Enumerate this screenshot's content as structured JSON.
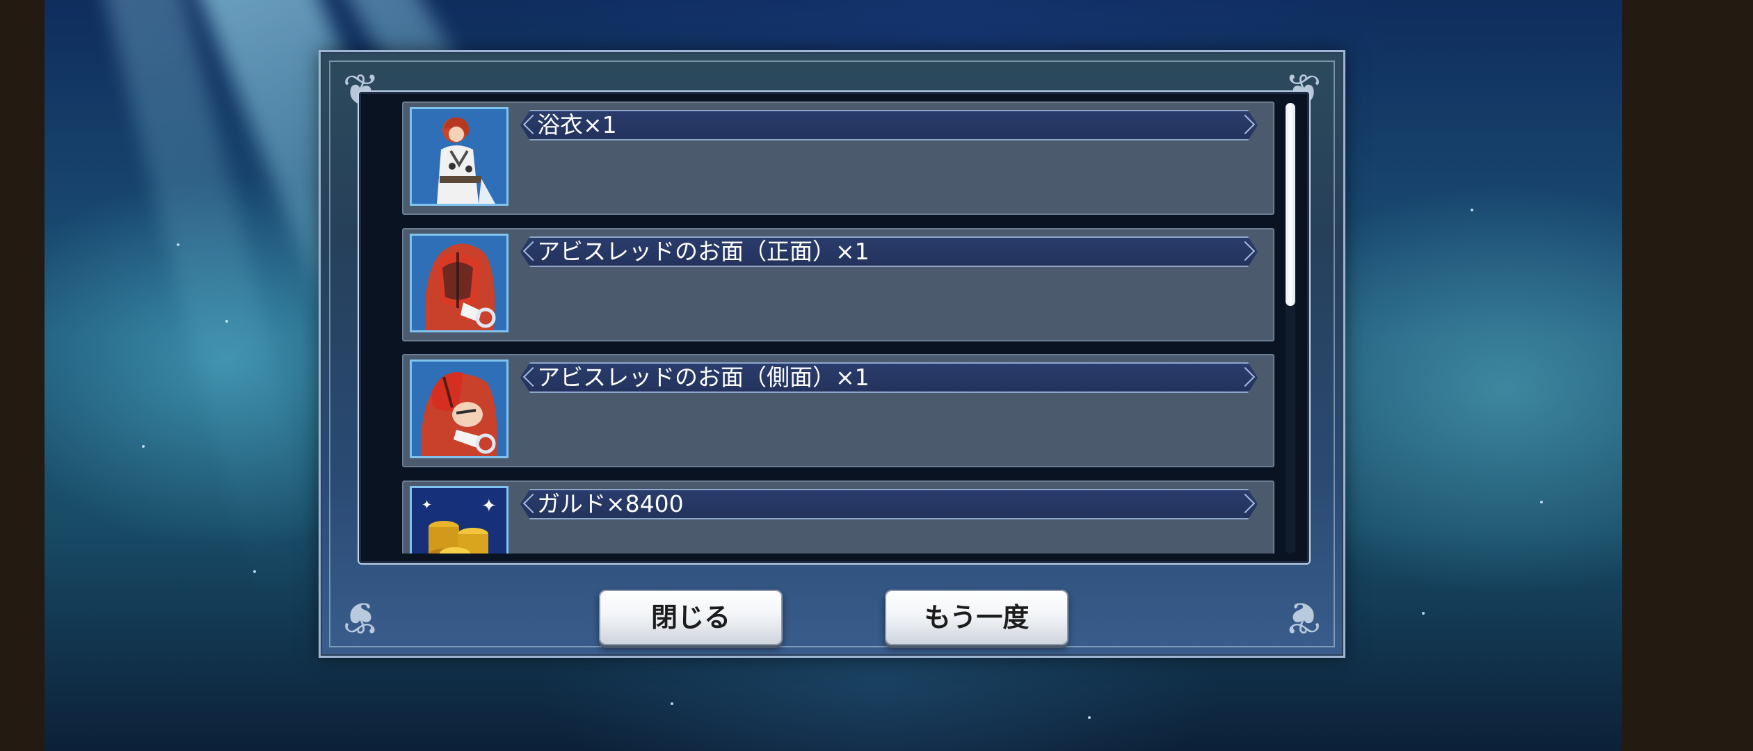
{
  "items": [
    {
      "name": "浴衣×1",
      "thumb_icon": "yukata-character-icon"
    },
    {
      "name": "アビスレッドのお面（正面）×1",
      "thumb_icon": "abyss-red-mask-front-icon"
    },
    {
      "name": "アビスレッドのお面（側面）×1",
      "thumb_icon": "abyss-red-mask-side-icon"
    },
    {
      "name": "ガルド×8400",
      "thumb_icon": "gald-coins-icon"
    }
  ],
  "scroll": {
    "visible_fraction": 0.45,
    "position_fraction": 0.0
  },
  "buttons": {
    "close_label": "閉じる",
    "again_label": "もう一度"
  },
  "colors": {
    "accent_bar": "#23335d",
    "item_bg": "#4b5a6c",
    "thumb_border": "#7fc3ee"
  }
}
